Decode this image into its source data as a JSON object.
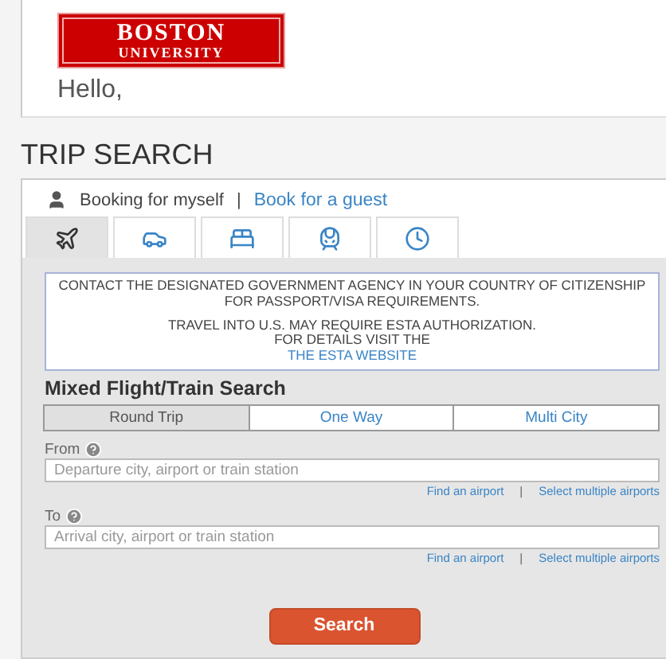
{
  "header": {
    "logo": {
      "line_1": "BOSTON",
      "line_2": "UNIVERSITY"
    },
    "greeting": "Hello,"
  },
  "page_title": "TRIP SEARCH",
  "booking": {
    "label": "Booking for myself",
    "separator": "|",
    "guest_link": "Book for a guest"
  },
  "tabs": [
    {
      "kind": "flight",
      "selected": true
    },
    {
      "kind": "car",
      "selected": false
    },
    {
      "kind": "hotel",
      "selected": false
    },
    {
      "kind": "train",
      "selected": false
    },
    {
      "kind": "history",
      "selected": false
    }
  ],
  "notice": {
    "paragraph_1": "CONTACT THE DESIGNATED GOVERNMENT AGENCY IN YOUR COUNTRY OF CITIZENSHIP FOR PASSPORT/VISA REQUIREMENTS.",
    "paragraph_2": "TRAVEL INTO U.S. MAY REQUIRE ESTA AUTHORIZATION.",
    "paragraph_3": "FOR DETAILS VISIT THE",
    "link": "THE ESTA WEBSITE"
  },
  "search_title": "Mixed Flight/Train Search",
  "trip_types": [
    {
      "label": "Round Trip",
      "selected": true
    },
    {
      "label": "One Way",
      "selected": false
    },
    {
      "label": "Multi City",
      "selected": false
    }
  ],
  "fields": [
    {
      "label": "From",
      "placeholder": "Departure city, airport or train station",
      "links": [
        "Find an airport",
        "Select multiple airports"
      ],
      "separator": "|"
    },
    {
      "label": "To",
      "placeholder": "Arrival city, airport or train station",
      "links": [
        "Find an airport",
        "Select multiple airports"
      ],
      "separator": "|"
    }
  ],
  "search_button": "Search"
}
